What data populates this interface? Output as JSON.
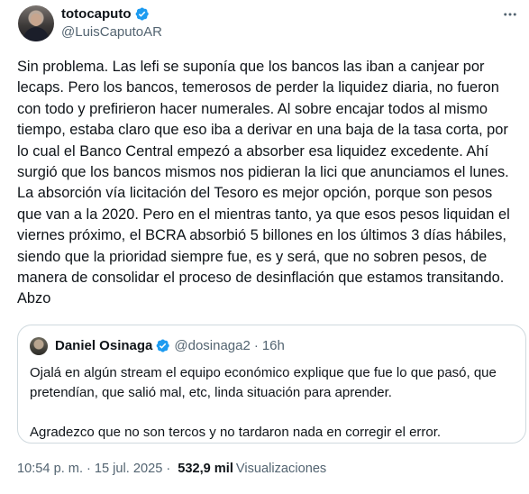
{
  "author": {
    "display_name": "totocaputo",
    "handle": "@LuisCaputoAR"
  },
  "tweet": {
    "text": "Sin problema. Las lefi se suponía que los bancos las iban a canjear por\nlecaps. Pero los bancos, temerosos de perder la liquidez diaria, no fueron\ncon todo y prefirieron hacer numerales. Al sobre encajar todos al mismo\ntiempo, estaba claro que eso iba a derivar en una baja de la tasa corta, por\nlo cual el Banco Central  empezó a absorber esa liquidez excedente. Ahí\nsurgió que los bancos mismos nos pidieran la lici que anunciamos el lunes.\nLa absorción vía licitación del Tesoro es mejor opción, porque son pesos\nque van a la 2020. Pero en el mientras tanto, ya que esos pesos liquidan el\nviernes próximo, el BCRA absorbió 5 billones en los últimos 3 días hábiles,\nsiendo que la prioridad siempre fue, es y será, que no sobren pesos, de\nmanera de consolidar el proceso de desinflación que estamos transitando.\nAbzo"
  },
  "quoted": {
    "display_name": "Daniel Osinaga",
    "handle": "@dosinaga2",
    "separator": "·",
    "time": "16h",
    "paragraph_1": "Ojalá en algún stream el equipo económico explique que fue lo que pasó, que pretendían, que salió mal, etc, linda situación para aprender.",
    "paragraph_2": "Agradezco que no son tercos y no tardaron nada en corregir el error."
  },
  "meta": {
    "time": "10:54 p. m.",
    "separator": "·",
    "date": "15 jul. 2025",
    "views_count": "532,9 mil",
    "views_label": "Visualizaciones"
  },
  "colors": {
    "verified_badge": "#1d9bf0",
    "secondary_text": "#536471",
    "border": "#cfd9de"
  },
  "icons": {
    "verified": "verified-badge-icon",
    "more": "more-horizontal-icon"
  }
}
